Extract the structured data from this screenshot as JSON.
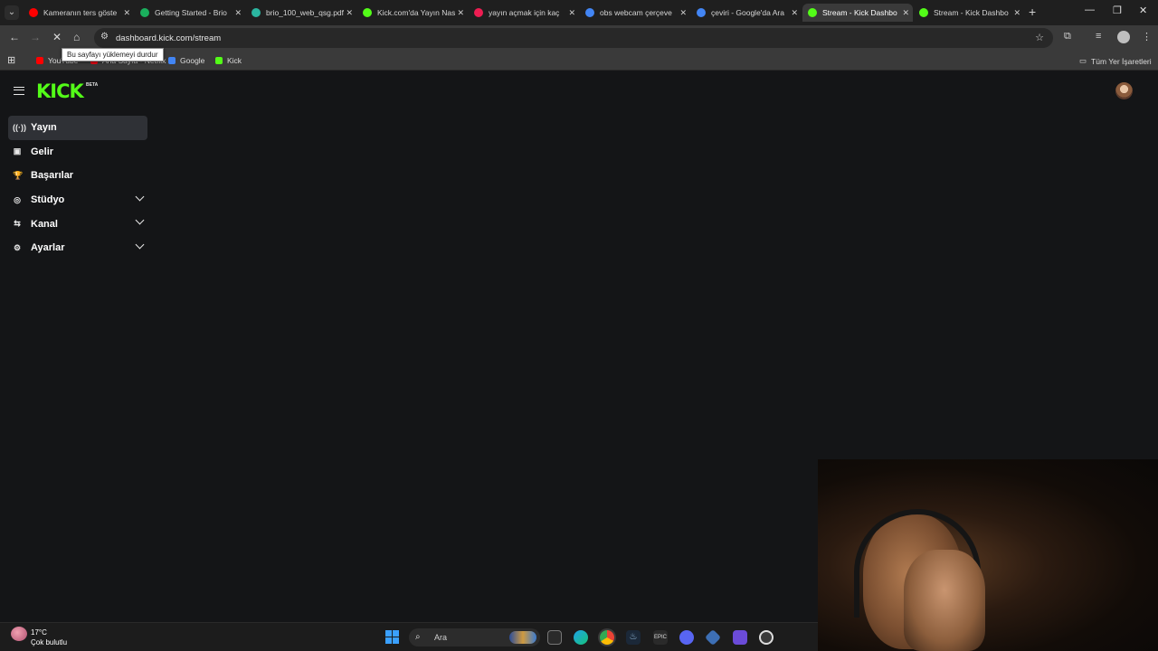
{
  "browser": {
    "tabs": [
      {
        "title": "Kameranın ters göste",
        "favicon": "youtube-icon",
        "color": "#ff0000",
        "active": false
      },
      {
        "title": "Getting Started - Brio",
        "favicon": "logi-icon",
        "color": "#1aaf5d",
        "active": false
      },
      {
        "title": "brio_100_web_qsg.pdf",
        "favicon": "pdf-icon",
        "color": "#2bb5a0",
        "active": false
      },
      {
        "title": "Kick.com'da Yayın Nas",
        "favicon": "kick-icon",
        "color": "#53fc18",
        "active": false
      },
      {
        "title": "yayın açmak için kaç",
        "favicon": "tiktok-icon",
        "color": "#ee1d52",
        "active": false
      },
      {
        "title": "obs webcam çerçeve",
        "favicon": "google-icon",
        "color": "#4285f4",
        "active": false
      },
      {
        "title": "çeviri - Google'da Ara",
        "favicon": "google-icon",
        "color": "#4285f4",
        "active": false
      },
      {
        "title": "Stream - Kick Dashbo",
        "favicon": "kick-icon",
        "color": "#53fc18",
        "active": true
      },
      {
        "title": "Stream - Kick Dashbo",
        "favicon": "kick-icon",
        "color": "#53fc18",
        "active": false
      }
    ],
    "url": "dashboard.kick.com/stream",
    "tooltip": "Bu sayfayı yüklemeyi durdur",
    "bookmarks": [
      {
        "label": "YouTube",
        "icon": "youtube-icon",
        "color": "#ff0000"
      },
      {
        "label": "Ana Sayfa - Netflix",
        "icon": "netflix-icon",
        "color": "#e50914"
      },
      {
        "label": "Google",
        "icon": "google-icon",
        "color": "#4285f4"
      },
      {
        "label": "Kick",
        "icon": "kick-icon",
        "color": "#53fc18"
      }
    ],
    "all_bookmarks": "Tüm Yer İşaretleri"
  },
  "kick": {
    "logo": "KICK",
    "beta": "BETA",
    "accent": "#53fc18",
    "nav": [
      {
        "label": "Yayın",
        "icon": "broadcast-icon",
        "glyph": "((·))",
        "active": true,
        "expandable": false
      },
      {
        "label": "Gelir",
        "icon": "revenue-icon",
        "glyph": "▣",
        "active": false,
        "expandable": false
      },
      {
        "label": "Başarılar",
        "icon": "trophy-icon",
        "glyph": "🏆",
        "active": false,
        "expandable": false
      },
      {
        "label": "Stüdyo",
        "icon": "studio-icon",
        "glyph": "◎",
        "active": false,
        "expandable": true
      },
      {
        "label": "Kanal",
        "icon": "channel-icon",
        "glyph": "⇆",
        "active": false,
        "expandable": true
      },
      {
        "label": "Ayarlar",
        "icon": "gear-icon",
        "glyph": "⚙",
        "active": false,
        "expandable": true
      }
    ]
  },
  "taskbar": {
    "temperature": "17°C",
    "condition": "Çok bulutlu",
    "search_placeholder": "Ara"
  }
}
